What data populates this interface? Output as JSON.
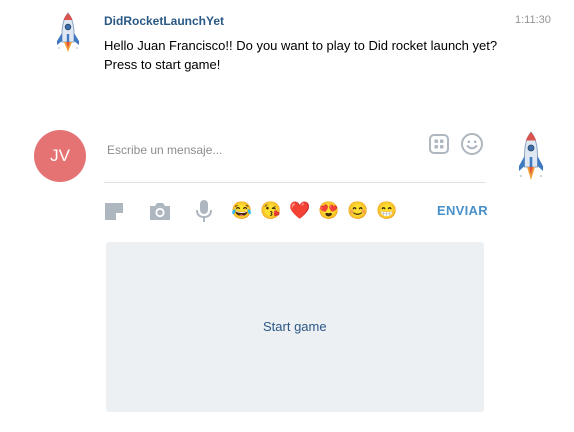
{
  "message": {
    "sender": "DidRocketLaunchYet",
    "time": "1:11:30",
    "text_line1": "Hello  Juan Francisco!! Do you want to play to Did rocket launch yet?",
    "text_line2": "Press to start game!"
  },
  "composer": {
    "avatar_initials": "JV",
    "placeholder": "Escribe un mensaje...",
    "send_label": "ENVIAR",
    "emojis": [
      "😂",
      "😘",
      "❤️",
      "😍",
      "😊",
      "😁"
    ]
  },
  "game": {
    "start_label": "Start game"
  },
  "colors": {
    "name": "#2a5885",
    "avatar_bg": "#e57373",
    "send": "#4a90c9",
    "panel": "#edf0f3",
    "icon": "#aeb6c0"
  },
  "icons": [
    "rocket-avatar",
    "stickers-icon",
    "smiley-icon",
    "document-icon",
    "camera-icon",
    "microphone-icon"
  ]
}
